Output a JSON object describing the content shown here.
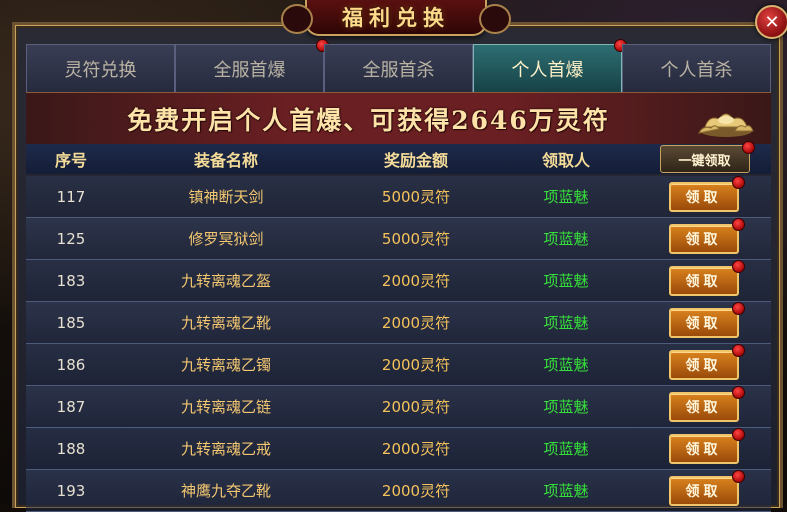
{
  "window": {
    "title": "福利兑换",
    "close_label": "✕"
  },
  "tabs": [
    {
      "label": "灵符兑换",
      "active": false,
      "badge": false
    },
    {
      "label": "全服首爆",
      "active": false,
      "badge": true
    },
    {
      "label": "全服首杀",
      "active": false,
      "badge": false
    },
    {
      "label": "个人首爆",
      "active": true,
      "badge": true
    },
    {
      "label": "个人首杀",
      "active": false,
      "badge": false
    }
  ],
  "banner": {
    "text": "免费开启个人首爆、可获得2646万灵符",
    "icon": "gold-ingot-icon"
  },
  "table": {
    "headers": {
      "id": "序号",
      "name": "装备名称",
      "amount": "奖励金额",
      "claimer": "领取人"
    },
    "claim_all_label": "一键领取",
    "claim_label": "领取",
    "rows": [
      {
        "id": "117",
        "name": "镇神断天剑",
        "amount": "5000灵符",
        "claimer": "项蓝魅"
      },
      {
        "id": "125",
        "name": "修罗冥狱剑",
        "amount": "5000灵符",
        "claimer": "项蓝魅"
      },
      {
        "id": "183",
        "name": "九转离魂乙盔",
        "amount": "2000灵符",
        "claimer": "项蓝魅"
      },
      {
        "id": "185",
        "name": "九转离魂乙靴",
        "amount": "2000灵符",
        "claimer": "项蓝魅"
      },
      {
        "id": "186",
        "name": "九转离魂乙镯",
        "amount": "2000灵符",
        "claimer": "项蓝魅"
      },
      {
        "id": "187",
        "name": "九转离魂乙链",
        "amount": "2000灵符",
        "claimer": "项蓝魅"
      },
      {
        "id": "188",
        "name": "九转离魂乙戒",
        "amount": "2000灵符",
        "claimer": "项蓝魅"
      },
      {
        "id": "193",
        "name": "神鹰九夺乙靴",
        "amount": "2000灵符",
        "claimer": "项蓝魅"
      }
    ]
  },
  "colors": {
    "accent_gold": "#c9a25e",
    "active_tab": "#2d6e73",
    "claimer_green": "#36e03a",
    "button_orange": "#d9821e"
  }
}
